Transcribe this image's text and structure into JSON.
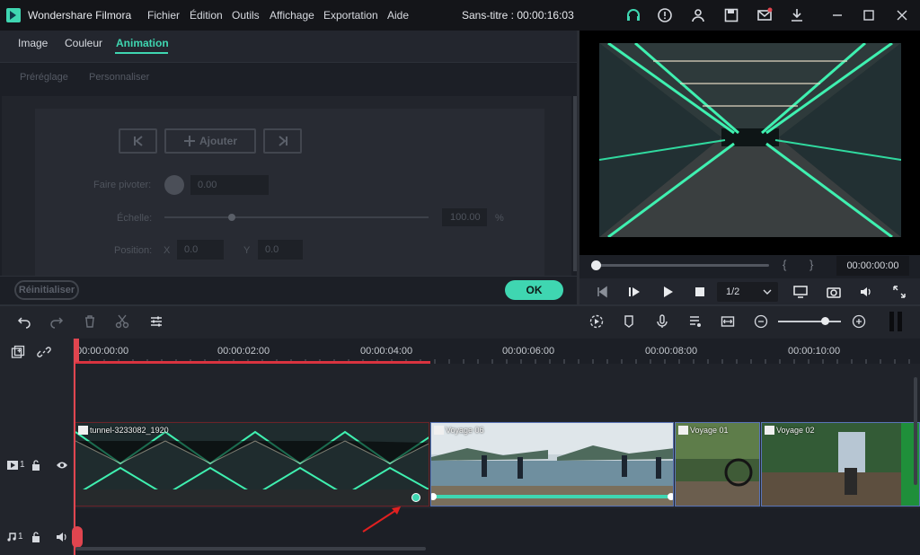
{
  "app": {
    "name": "Wondershare Filmora",
    "project_title": "Sans-titre : 00:00:16:03"
  },
  "menu": [
    "Fichier",
    "Édition",
    "Outils",
    "Affichage",
    "Exportation",
    "Aide"
  ],
  "title_icons": [
    "headset-icon",
    "info-icon",
    "account-icon",
    "save-icon",
    "mail-icon",
    "download-icon"
  ],
  "window_controls": [
    "minimize-icon",
    "maximize-icon",
    "close-icon"
  ],
  "editor_tabs": [
    "Image",
    "Couleur",
    "Animation"
  ],
  "active_tab": "Animation",
  "sub_tabs": [
    "Préréglage",
    "Personnaliser"
  ],
  "keyframe": {
    "prev": "|<",
    "add": "Ajouter",
    "next": ">|"
  },
  "props": {
    "rotate_label": "Faire pivoter:",
    "rotate_value": "0.00",
    "scale_label": "Échelle:",
    "scale_value": "100.00",
    "scale_unit": "%",
    "scale_level": 0.25,
    "position_label": "Position:",
    "x_label": "X",
    "x_value": "0.0",
    "y_label": "Y",
    "y_value": "0.0"
  },
  "buttons": {
    "reset": "Réinitialiser",
    "ok": "OK"
  },
  "preview": {
    "time": "00:00:00:00",
    "brace_open": "{",
    "brace_close": "}",
    "ratio": "1/2",
    "scrub_position": 0.0
  },
  "timeline": {
    "ticks": [
      "00:00:00:00",
      "00:00:02:00",
      "00:00:04:00",
      "00:00:06:00",
      "00:00:08:00",
      "00:00:10:00"
    ],
    "tracks": {
      "video": "1",
      "audio": "1"
    },
    "clips": [
      "tunnel-3233082_1920",
      "Voyage 06",
      "Voyage 01",
      "Voyage 02"
    ]
  },
  "colors": {
    "accent": "#3fd6b1",
    "playhead": "#e0454f",
    "clip_border": "#5a75b8"
  }
}
